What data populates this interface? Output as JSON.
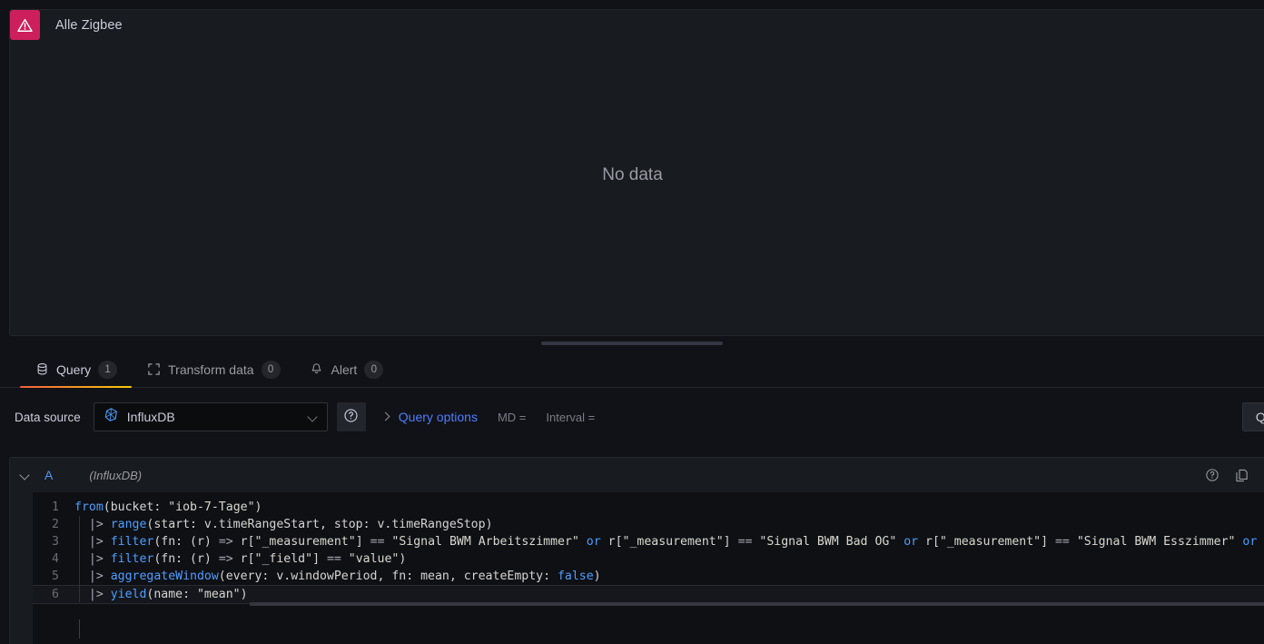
{
  "panel": {
    "title": "Alle Zigbee",
    "alert_icon": "alert-triangle-icon",
    "alert_color": "#cc1f5c",
    "no_data_text": "No data"
  },
  "tabs": [
    {
      "label": "Query",
      "icon": "database-icon",
      "count": "1",
      "active": true
    },
    {
      "label": "Transform data",
      "icon": "transform-icon",
      "count": "0",
      "active": false
    },
    {
      "label": "Alert",
      "icon": "bell-icon",
      "count": "0",
      "active": false
    }
  ],
  "datasource_row": {
    "label": "Data source",
    "selected": "InfluxDB",
    "datasource_icon": "influxdb-icon",
    "help_icon": "question-circle-icon",
    "query_options_label": "Query options",
    "max_data_points": "MD =",
    "interval": "Interval =",
    "query_button": "Query",
    "accent_color": "#4d7cfe"
  },
  "query": {
    "ref_id": "A",
    "datasource_name": "(InfluxDB)",
    "help_icon": "question-circle-icon",
    "copy_icon": "copy-icon",
    "editor": {
      "language": "flux",
      "lines": [
        {
          "number": "1",
          "current": false,
          "tokens": [
            {
              "t": "from",
              "c": "fn"
            },
            {
              "t": "(bucket: ",
              "c": "plain"
            },
            {
              "t": "\"iob-7-Tage\"",
              "c": "str"
            },
            {
              "t": ")",
              "c": "plain"
            }
          ]
        },
        {
          "number": "2",
          "current": false,
          "tokens": [
            {
              "t": "  |> ",
              "c": "op"
            },
            {
              "t": "range",
              "c": "fn"
            },
            {
              "t": "(start: v.timeRangeStart, stop: v.timeRangeStop)",
              "c": "plain"
            }
          ]
        },
        {
          "number": "3",
          "current": false,
          "tokens": [
            {
              "t": "  |> ",
              "c": "op"
            },
            {
              "t": "filter",
              "c": "fn"
            },
            {
              "t": "(fn: (r) ",
              "c": "plain"
            },
            {
              "t": "=>",
              "c": "op"
            },
            {
              "t": " r[",
              "c": "plain"
            },
            {
              "t": "\"_measurement\"",
              "c": "str"
            },
            {
              "t": "] ",
              "c": "plain"
            },
            {
              "t": "==",
              "c": "op"
            },
            {
              "t": " ",
              "c": "plain"
            },
            {
              "t": "\"Signal BWM Arbeitszimmer\"",
              "c": "str"
            },
            {
              "t": " or ",
              "c": "kw"
            },
            {
              "t": "r[",
              "c": "plain"
            },
            {
              "t": "\"_measurement\"",
              "c": "str"
            },
            {
              "t": "] ",
              "c": "plain"
            },
            {
              "t": "==",
              "c": "op"
            },
            {
              "t": " ",
              "c": "plain"
            },
            {
              "t": "\"Signal BWM Bad OG\"",
              "c": "str"
            },
            {
              "t": " or ",
              "c": "kw"
            },
            {
              "t": "r[",
              "c": "plain"
            },
            {
              "t": "\"_measurement\"",
              "c": "str"
            },
            {
              "t": "] ",
              "c": "plain"
            },
            {
              "t": "==",
              "c": "op"
            },
            {
              "t": " ",
              "c": "plain"
            },
            {
              "t": "\"Signal BWM Esszimmer\"",
              "c": "str"
            },
            {
              "t": " or",
              "c": "kw"
            }
          ]
        },
        {
          "number": "4",
          "current": false,
          "tokens": [
            {
              "t": "  |> ",
              "c": "op"
            },
            {
              "t": "filter",
              "c": "fn"
            },
            {
              "t": "(fn: (r) ",
              "c": "plain"
            },
            {
              "t": "=>",
              "c": "op"
            },
            {
              "t": " r[",
              "c": "plain"
            },
            {
              "t": "\"_field\"",
              "c": "str"
            },
            {
              "t": "] ",
              "c": "plain"
            },
            {
              "t": "==",
              "c": "op"
            },
            {
              "t": " ",
              "c": "plain"
            },
            {
              "t": "\"value\"",
              "c": "str"
            },
            {
              "t": ")",
              "c": "plain"
            }
          ]
        },
        {
          "number": "5",
          "current": false,
          "tokens": [
            {
              "t": "  |> ",
              "c": "op"
            },
            {
              "t": "aggregateWindow",
              "c": "fn"
            },
            {
              "t": "(every: v.windowPeriod, fn: mean, createEmpty: ",
              "c": "plain"
            },
            {
              "t": "false",
              "c": "kw"
            },
            {
              "t": ")",
              "c": "plain"
            }
          ]
        },
        {
          "number": "6",
          "current": true,
          "tokens": [
            {
              "t": "  |> ",
              "c": "op"
            },
            {
              "t": "yield",
              "c": "fn"
            },
            {
              "t": "(name: ",
              "c": "plain"
            },
            {
              "t": "\"mean\"",
              "c": "str"
            },
            {
              "t": ")",
              "c": "plain"
            }
          ]
        }
      ]
    }
  }
}
